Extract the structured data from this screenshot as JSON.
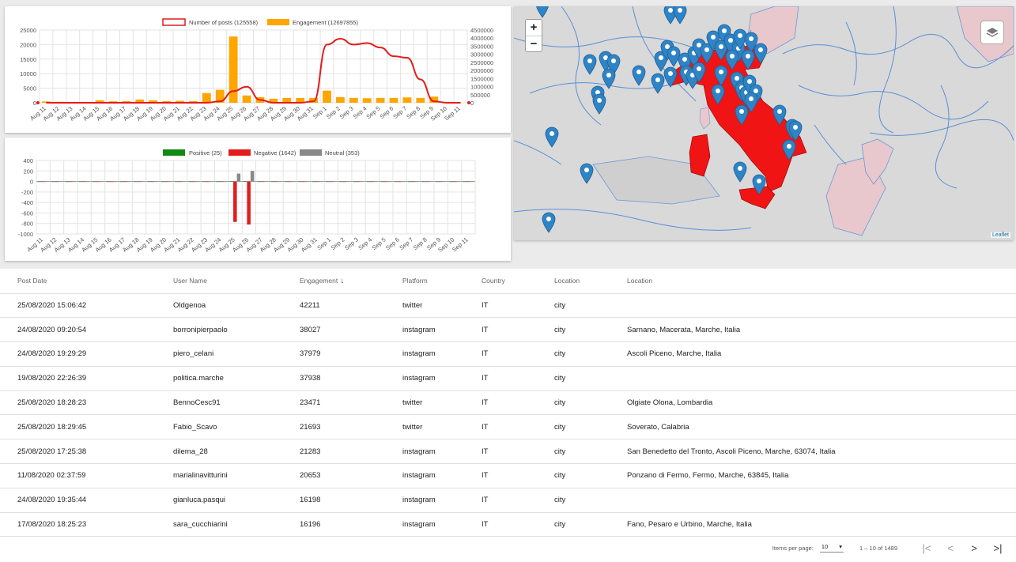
{
  "posts_chart": {
    "legend_posts": "Number of posts (125558)",
    "legend_engagement": "Engagement (12697855)",
    "color_posts": "#e31c1c",
    "color_engagement": "#ffa500"
  },
  "sentiment_chart": {
    "legend_positive": "Positive (25)",
    "legend_negative": "Negative (1642)",
    "legend_neutral": "Neutral (353)",
    "color_positive": "#108a10",
    "color_negative": "#e31c1c",
    "color_neutral": "#888888"
  },
  "chart_data": [
    {
      "type": "bar",
      "title": "",
      "categories": [
        "Aug 11",
        "Aug 12",
        "Aug 13",
        "Aug 14",
        "Aug 15",
        "Aug 16",
        "Aug 17",
        "Aug 18",
        "Aug 19",
        "Aug 20",
        "Aug 21",
        "Aug 22",
        "Aug 23",
        "Aug 24",
        "Aug 25",
        "Aug 26",
        "Aug 27",
        "Aug 28",
        "Aug 29",
        "Aug 30",
        "Aug 31",
        "Sep 1",
        "Sep 2",
        "Sep 3",
        "Sep 4",
        "Sep 5",
        "Sep 6",
        "Sep 7",
        "Sep 8",
        "Sep 9",
        "Sep 10",
        "Sep 11"
      ],
      "series": [
        {
          "name": "Number of posts (125558)",
          "type": "line",
          "axis": "left",
          "values": [
            0,
            0,
            0,
            0,
            0,
            0,
            0,
            0,
            0,
            0,
            0,
            0,
            0,
            500,
            4000,
            5500,
            1000,
            0,
            0,
            0,
            500,
            20000,
            22000,
            20000,
            20500,
            19000,
            16000,
            15500,
            8000,
            500,
            0,
            0
          ]
        },
        {
          "name": "Engagement (12697855)",
          "type": "bar",
          "axis": "right",
          "values": [
            80000,
            60000,
            40000,
            50000,
            150000,
            90000,
            100000,
            200000,
            150000,
            100000,
            120000,
            100000,
            600000,
            800000,
            4100000,
            450000,
            350000,
            250000,
            300000,
            300000,
            300000,
            750000,
            350000,
            300000,
            280000,
            300000,
            300000,
            330000,
            300000,
            380000,
            0,
            0
          ]
        }
      ],
      "ylim": [
        0,
        25000
      ],
      "ylim_right": [
        0,
        4500000
      ],
      "yticks": [
        "25000",
        "20000",
        "15000",
        "10000",
        "5000",
        "0"
      ],
      "yticks_right": [
        "4500000",
        "4000000",
        "3500000",
        "3000000",
        "2500000",
        "2000000",
        "1500000",
        "1000000",
        "500000",
        "0"
      ],
      "grid": true,
      "legend": "top"
    },
    {
      "type": "bar",
      "title": "",
      "categories": [
        "Aug 11",
        "Aug 12",
        "Aug 13",
        "Aug 14",
        "Aug 15",
        "Aug 16",
        "Aug 17",
        "Aug 18",
        "Aug 19",
        "Aug 20",
        "Aug 21",
        "Aug 22",
        "Aug 23",
        "Aug 24",
        "Aug 25",
        "Aug 26",
        "Aug 27",
        "Aug 28",
        "Aug 29",
        "Aug 30",
        "Aug 31",
        "Sep 1",
        "Sep 2",
        "Sep 3",
        "Sep 4",
        "Sep 5",
        "Sep 6",
        "Sep 7",
        "Sep 8",
        "Sep 9",
        "Sep 10",
        "Sep 11"
      ],
      "series": [
        {
          "name": "Positive (25)",
          "values": [
            0,
            0,
            0,
            0,
            0,
            0,
            0,
            0,
            0,
            0,
            0,
            0,
            0,
            0,
            3,
            4,
            0,
            0,
            0,
            0,
            0,
            0,
            0,
            0,
            0,
            0,
            0,
            0,
            0,
            0,
            0,
            0
          ]
        },
        {
          "name": "Negative (1642)",
          "values": [
            -6,
            -4,
            -5,
            -4,
            -8,
            -5,
            -4,
            -9,
            -7,
            -4,
            0,
            0,
            -8,
            -5,
            -770,
            -820,
            -6,
            0,
            0,
            0,
            0,
            0,
            0,
            0,
            0,
            0,
            0,
            0,
            0,
            0,
            0,
            0
          ]
        },
        {
          "name": "Neutral (353)",
          "values": [
            0,
            0,
            0,
            0,
            0,
            0,
            0,
            0,
            0,
            0,
            0,
            0,
            0,
            0,
            150,
            200,
            0,
            0,
            0,
            0,
            0,
            0,
            0,
            0,
            0,
            0,
            0,
            0,
            0,
            0,
            0,
            0
          ]
        }
      ],
      "ylim": [
        -1000,
        400
      ],
      "yticks": [
        "400",
        "200",
        "0",
        "-200",
        "-400",
        "-600",
        "-800",
        "-1000"
      ],
      "grid": true,
      "legend": "top"
    }
  ],
  "map": {
    "zoom_in": "+",
    "zoom_out": "−",
    "attribution": "Leaflet"
  },
  "table": {
    "headers": [
      "Post Date",
      "User Name",
      "Engagement",
      "Platform",
      "Country",
      "Location",
      "Location"
    ],
    "sort_arrow": "↓",
    "rows": [
      [
        "25/08/2020 15:06:42",
        "Oldgenoa",
        "42211",
        "twitter",
        "IT",
        "city",
        ""
      ],
      [
        "24/08/2020 09:20:54",
        "borronipierpaolo",
        "38027",
        "instagram",
        "IT",
        "city",
        "Sarnano, Macerata, Marche, Italia"
      ],
      [
        "24/08/2020 19:29:29",
        "piero_celani",
        "37979",
        "instagram",
        "IT",
        "city",
        "Ascoli Piceno, Marche, Italia"
      ],
      [
        "19/08/2020 22:26:39",
        "politica.marche",
        "37938",
        "instagram",
        "IT",
        "city",
        ""
      ],
      [
        "25/08/2020 18:28:23",
        "BennoCesc91",
        "23471",
        "twitter",
        "IT",
        "city",
        "Olgiate Olona, Lombardia"
      ],
      [
        "25/08/2020 18:29:45",
        "Fabio_Scavo",
        "21693",
        "twitter",
        "IT",
        "city",
        "Soverato, Calabria"
      ],
      [
        "25/08/2020 17:25:38",
        "dilema_28",
        "21283",
        "instagram",
        "IT",
        "city",
        "San Benedetto del Tronto, Ascoli Piceno, Marche, 63074, Italia"
      ],
      [
        "11/08/2020 02:37:59",
        "marialinavitturini",
        "20653",
        "instagram",
        "IT",
        "city",
        "Ponzano di Fermo, Fermo, Marche, 63845, Italia"
      ],
      [
        "24/08/2020 19:35:44",
        "gianluca.pasqui",
        "16198",
        "instagram",
        "IT",
        "city",
        ""
      ],
      [
        "17/08/2020 18:25:23",
        "sara_cucchiarini",
        "16196",
        "instagram",
        "IT",
        "city",
        "Fano, Pesaro e Urbino, Marche, Italia"
      ]
    ]
  },
  "paginator": {
    "items_per_page_label": "Items per page:",
    "page_size": "10",
    "range_label": "1 – 10 of 1489",
    "first": "|<",
    "prev": "<",
    "next": ">",
    "last": ">|"
  }
}
